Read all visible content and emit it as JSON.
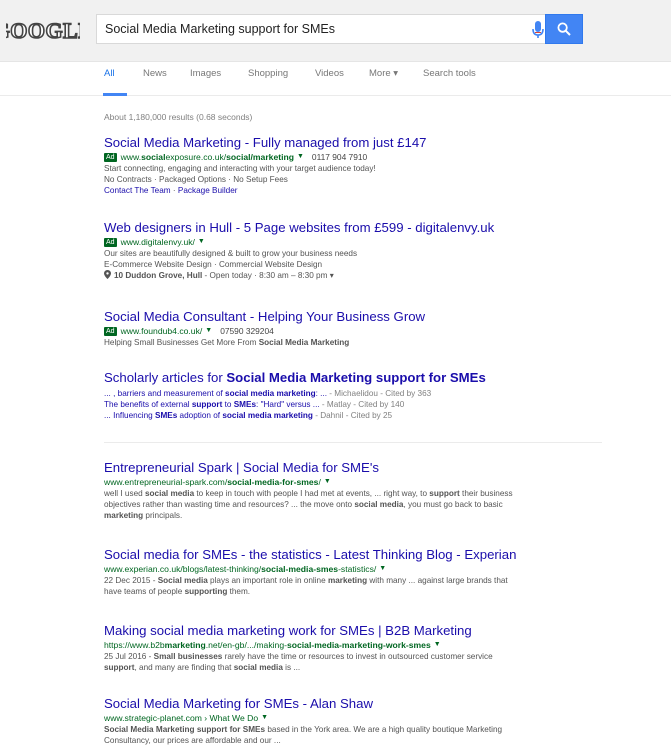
{
  "logo": {
    "text": "GOOGLE"
  },
  "search": {
    "query": "Social Media Marketing support for SMEs"
  },
  "tabs": [
    {
      "label": "All"
    },
    {
      "label": "News"
    },
    {
      "label": "Images"
    },
    {
      "label": "Shopping"
    },
    {
      "label": "Videos"
    },
    {
      "label": "More ▾"
    },
    {
      "label": "Search tools"
    }
  ],
  "stats": "About 1,180,000 results (0.68 seconds)",
  "ads": [
    {
      "title": "Social Media Marketing - Fully managed from just £147",
      "badge": "Ad",
      "url_pre": "www.",
      "url_b1": "social",
      "url_mid": "exposure.co.uk/",
      "url_b2": "social/marketing",
      "phone": "0117 904 7910",
      "line1": "Start connecting, engaging and interacting with your target audience today!",
      "line2": "No Contracts · Packaged Options · No Setup Fees",
      "link1": "Contact The Team",
      "link2": "Package Builder"
    },
    {
      "title": "Web designers in Hull - 5 Page websites from £599 - digitalenvy.uk",
      "badge": "Ad",
      "url": "www.digitalenvy.uk/",
      "line1": "Our sites are beautifully designed & built to grow your business needs",
      "line2": "E-Commerce Website Design · Commercial Website Design",
      "address": "10 Duddon Grove, Hull",
      "hours": " - Open today · 8:30 am – 8:30 pm ▾"
    },
    {
      "title": "Social Media Consultant - Helping Your Business Grow",
      "badge": "Ad",
      "url": "www.foundub4.co.uk/",
      "phone": "07590 329204",
      "line_pre": "Helping Small Businesses Get More From ",
      "line_b": "Social Media Marketing"
    }
  ],
  "scholar": {
    "title_pre": "Scholarly articles for ",
    "title_b": "Social Media Marketing support for SMEs",
    "items": [
      {
        "pre": "... , barriers and measurement of ",
        "b": "social media marketing",
        "post": ": ... ",
        "author": "- Michaelidou",
        "cite": " - Cited by 363"
      },
      {
        "pre": "The benefits of external ",
        "b": "support",
        "mid": " to ",
        "b2": "SMEs",
        "post": ": \"Hard\" versus ... ",
        "author": "- Matlay",
        "cite": " - Cited by 140"
      },
      {
        "pre": "... Influencing ",
        "b": "SMEs",
        "mid": " adoption of ",
        "b2": "social media marketing",
        "post": " ",
        "author": "- Dahnil",
        "cite": " - Cited by 25"
      }
    ]
  },
  "organic": [
    {
      "title": "Entrepreneurial Spark | Social Media for SME's",
      "url_pre": "www.entrepreneurial-spark.com/",
      "url_b": "social-media-for-smes",
      "url_post": "/",
      "snippet": [
        {
          "t": "well I used "
        },
        {
          "b": "social media"
        },
        {
          "t": " to keep in touch with people I had met at events, ... right way, to "
        },
        {
          "b": "support"
        },
        {
          "t": " their business objectives rather than wasting time and resources? ... the move onto "
        },
        {
          "b": "social media"
        },
        {
          "t": ", you must go back to basic "
        },
        {
          "b": "marketing"
        },
        {
          "t": " principals."
        }
      ]
    },
    {
      "title": "Social media for SMEs - the statistics - Latest Thinking Blog - Experian",
      "url_pre": "www.experian.co.uk/blogs/latest-thinking/",
      "url_b": "social-media-smes",
      "url_post": "-statistics/",
      "snippet": [
        {
          "t": "22 Dec 2015 - "
        },
        {
          "b": "Social media"
        },
        {
          "t": " plays an important role in online "
        },
        {
          "b": "marketing"
        },
        {
          "t": " with many ... against large brands that have teams of people "
        },
        {
          "b": "supporting"
        },
        {
          "t": " them."
        }
      ]
    },
    {
      "title": "Making social media marketing work for SMEs | B2B Marketing",
      "url_pre": "https://www.b2b",
      "url_b": "marketing",
      "url_mid": ".net/en-gb/.../making-",
      "url_b2": "social-media-marketing-work-smes",
      "snippet": [
        {
          "t": "25 Jul 2016 - "
        },
        {
          "b": "Small businesses"
        },
        {
          "t": " rarely have the time or resources to invest in outsourced customer service "
        },
        {
          "b": "support"
        },
        {
          "t": ", and many are finding that "
        },
        {
          "b": "social media"
        },
        {
          "t": " is ..."
        }
      ]
    },
    {
      "title": "Social Media Marketing for SMEs - Alan Shaw",
      "url": "www.strategic-planet.com › What We Do",
      "snippet": [
        {
          "b": "Social Media Marketing support for SMEs"
        },
        {
          "t": " based in the York area. We are a high quality boutique Marketing Consultancy, our prices are affordable and our ..."
        }
      ]
    }
  ],
  "colors": {
    "link": "#1a0dab",
    "url_green": "#006621",
    "accent_blue": "#4285f4",
    "snippet_gray": "#545454"
  }
}
